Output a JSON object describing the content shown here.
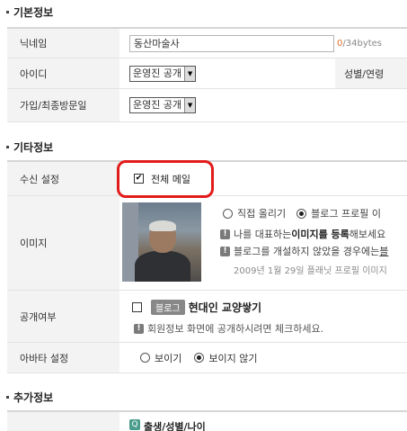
{
  "sections": {
    "basic": "기본정보",
    "other": "기타정보",
    "extra": "추가정보"
  },
  "basic": {
    "nickname": {
      "label": "닉네임",
      "value": "동산마술사",
      "count": "0",
      "max": "/34bytes"
    },
    "id": {
      "label": "아이디",
      "visibility": "운영진 공개",
      "side_label": "성별/연령",
      "visibility2": ""
    },
    "join": {
      "label": "가입/최종방문일",
      "visibility": "운영진 공개"
    }
  },
  "other": {
    "receive": {
      "label": "수신 설정",
      "option": "전체 메일",
      "checked": true
    },
    "image": {
      "label": "이미지",
      "radio_direct": "직접 올리기",
      "radio_blog": "블로그 프로필 이",
      "line1_pre": "나를 대표하는 ",
      "line1_bold": "이미지를 등록",
      "line1_post": "해보세요",
      "line2_pre": "블로그를 개설하지 않았을 경우에는 ",
      "line2_link": "블",
      "date": "2009년 1월 29일 플래닛 프로필 이미지"
    },
    "public": {
      "label": "공개여부",
      "tag": "블로그",
      "blog_name": "현대인 교양쌓기",
      "note": "회원정보 화면에 공개하시려면 체크하세요."
    },
    "avatar": {
      "label": "아바타 설정",
      "show": "보이기",
      "hide": "보이지 않기"
    }
  },
  "extra": {
    "item": "출생/성별/나이"
  },
  "icons": {
    "warning": "!",
    "check": "✔",
    "dropdown": "▼",
    "extra_icon": "Q"
  },
  "colors": {
    "highlight": "#e21b1b",
    "counter": "#e0702e"
  }
}
